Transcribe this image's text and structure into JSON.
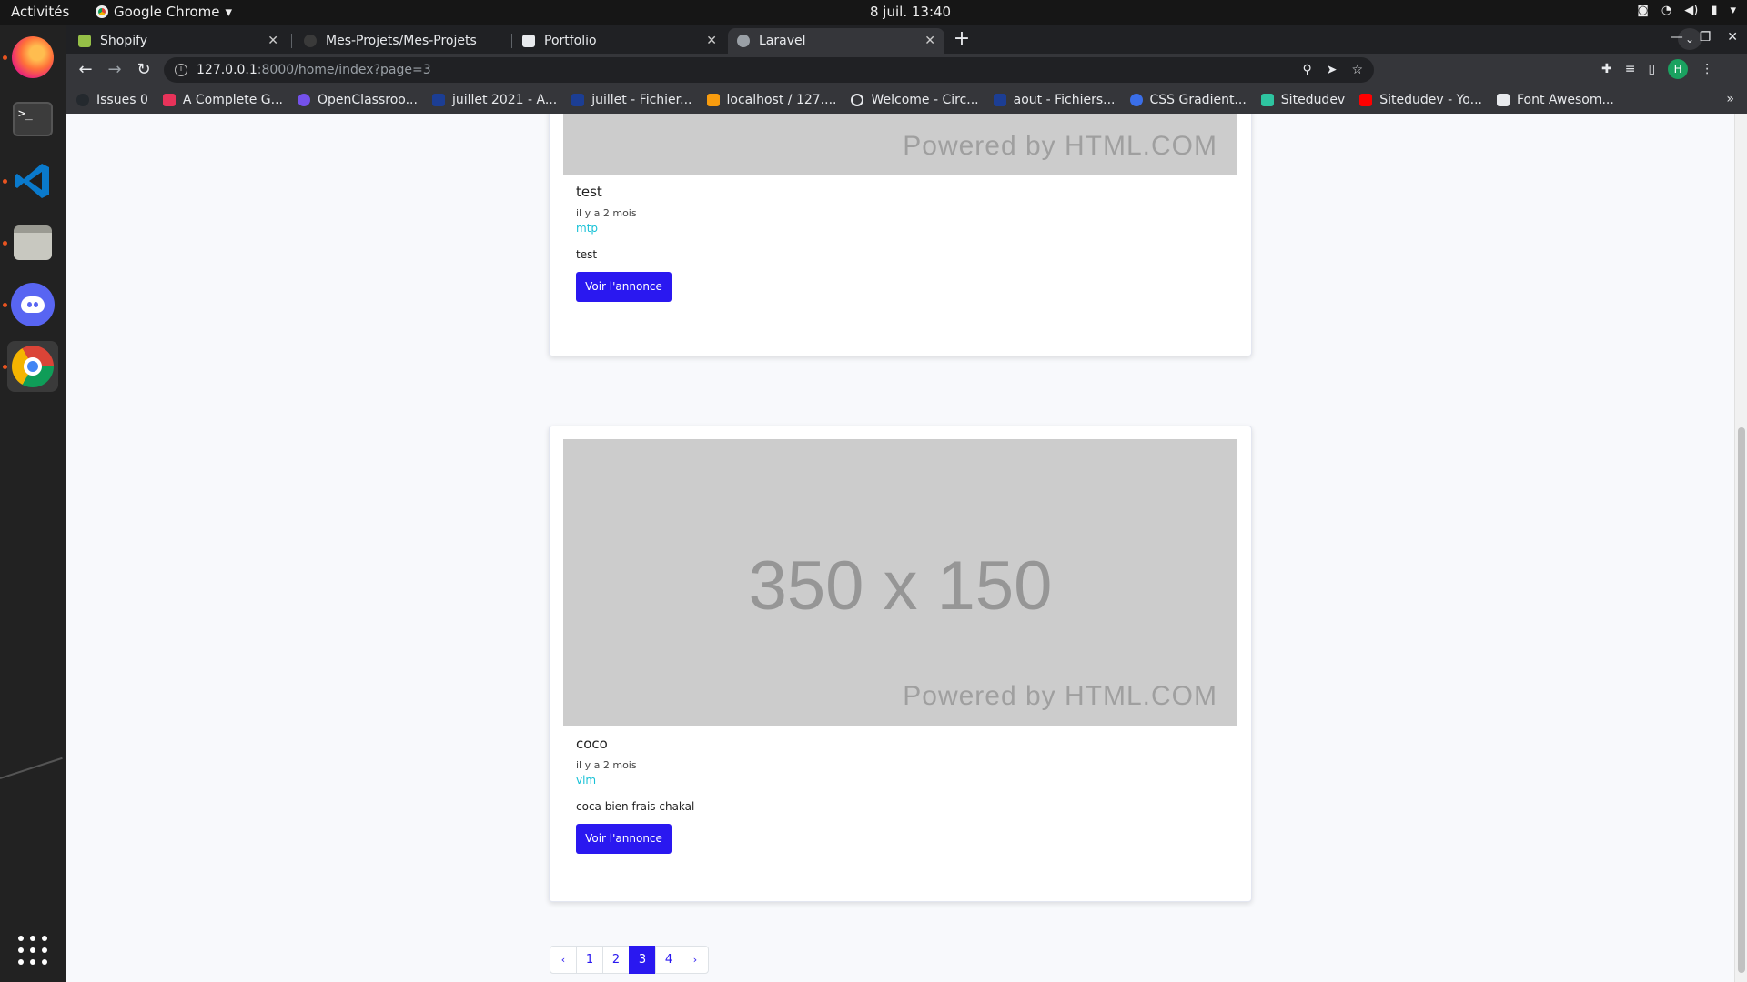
{
  "topbar": {
    "activities": "Activités",
    "app_name": "Google Chrome",
    "clock": "8 juil.  13:40"
  },
  "tabs": [
    {
      "title": "Shopify",
      "color": "#95bf47"
    },
    {
      "title": "Mes-Projets/Mes-Projets",
      "color": "#24292e"
    },
    {
      "title": "Portfolio",
      "color": "#ffffff"
    },
    {
      "title": "Laravel",
      "color": "#9aa0a6"
    }
  ],
  "address": {
    "host": "127.0.0.1",
    "rest": ":8000/home/index?page=3"
  },
  "bookmarks": [
    {
      "label": "Issues 0",
      "color": "#24292e"
    },
    {
      "label": "A Complete G...",
      "color": "#e8335a"
    },
    {
      "label": "OpenClassroo...",
      "color": "#7451eb"
    },
    {
      "label": "juillet 2021 - A...",
      "color": "#1c3e94"
    },
    {
      "label": "juillet - Fichier...",
      "color": "#1c3e94"
    },
    {
      "label": "localhost / 127....",
      "color": "#f89c0e"
    },
    {
      "label": "Welcome - Circ...",
      "color": "#e8eaed"
    },
    {
      "label": "aout - Fichiers...",
      "color": "#1c3e94"
    },
    {
      "label": "CSS Gradient...",
      "color": "#3a6ee8"
    },
    {
      "label": "Sitedudev",
      "color": "#2ec4a0"
    },
    {
      "label": "Sitedudev - Yo...",
      "color": "#ff0000"
    },
    {
      "label": "Font Awesom...",
      "color": "#e8eaed"
    }
  ],
  "cards": [
    {
      "title": "test",
      "time": "il y a 2 mois",
      "city": "mtp",
      "description": "test",
      "button": "Voir l'annonce",
      "image_powered": "Powered by HTML.COM"
    },
    {
      "title": "coco",
      "time": "il y a 2 mois",
      "city": "vlm",
      "description": "coca bien frais chakal",
      "button": "Voir l'annonce",
      "image_size": "350 x 150",
      "image_powered": "Powered by HTML.COM"
    }
  ],
  "pagination": {
    "prev": "‹",
    "pages": [
      "1",
      "2",
      "3",
      "4"
    ],
    "active_page": "3",
    "next": "›"
  },
  "colors": {
    "accent": "#2a18f0",
    "city_link": "#17c1d6"
  }
}
